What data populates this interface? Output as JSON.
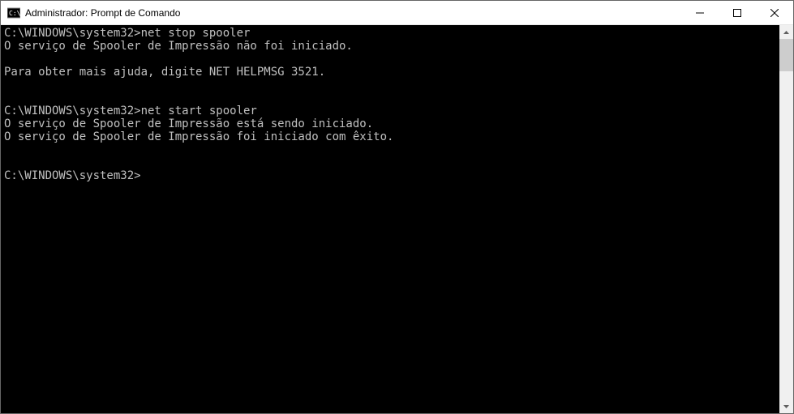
{
  "window": {
    "title": "Administrador: Prompt de Comando"
  },
  "terminal": {
    "lines": [
      {
        "prompt": "C:\\WINDOWS\\system32>",
        "cmd": "net stop spooler"
      },
      {
        "text": "O serviço de Spooler de Impressão não foi iniciado."
      },
      {
        "text": ""
      },
      {
        "text": "Para obter mais ajuda, digite NET HELPMSG 3521."
      },
      {
        "text": ""
      },
      {
        "text": ""
      },
      {
        "prompt": "C:\\WINDOWS\\system32>",
        "cmd": "net start spooler"
      },
      {
        "text": "O serviço de Spooler de Impressão está sendo iniciado."
      },
      {
        "text": "O serviço de Spooler de Impressão foi iniciado com êxito."
      },
      {
        "text": ""
      },
      {
        "text": ""
      },
      {
        "prompt": "C:\\WINDOWS\\system32>",
        "cmd": ""
      }
    ]
  }
}
